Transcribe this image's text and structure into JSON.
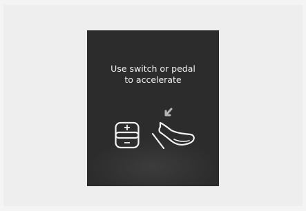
{
  "dialog": {
    "message_line1": "Use switch or pedal",
    "message_line2": "to accelerate"
  },
  "icons": {
    "switch": "accelerator-switch-icon",
    "pedal": "foot-pedal-icon"
  },
  "colors": {
    "panel_background": "#2c2c2c",
    "text": "#f2f2f2",
    "page_background": "#eeeeee"
  }
}
